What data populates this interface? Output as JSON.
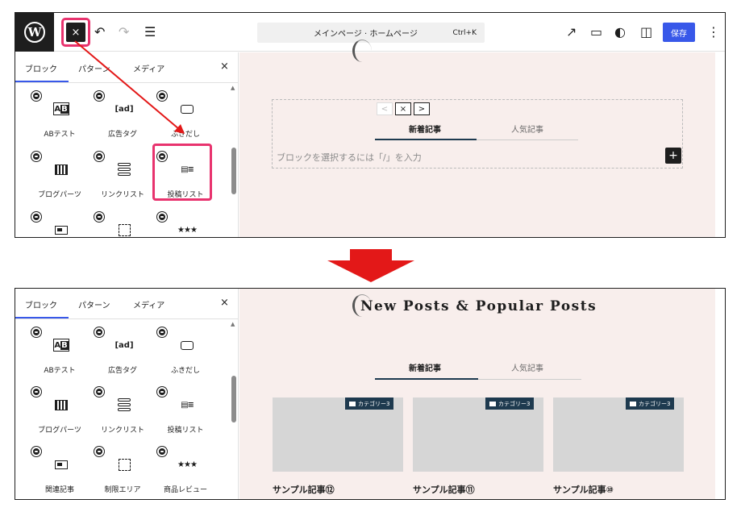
{
  "toolbar": {
    "wp_logo": "W",
    "close_icon": "×",
    "undo_icon": "↶",
    "redo_icon": "↷",
    "outline_icon": "☰",
    "command_text": "メインページ · ホームページ",
    "command_shortcut": "Ctrl+K",
    "view_icon": "↗",
    "device_icon": "▭",
    "style_icon": "◐",
    "settings_icon": "◫",
    "save_label": "保存",
    "more_icon": "⋮"
  },
  "inserter": {
    "tabs": [
      "ブロック",
      "パターン",
      "メディア"
    ],
    "close_icon": "×",
    "scroll_up_icon": "▲",
    "blocks": [
      {
        "label": "ABテスト",
        "icon": "ab-test-icon"
      },
      {
        "label": "広告タグ",
        "icon": "ad-tag-icon",
        "glyph": "[ad]"
      },
      {
        "label": "ふきだし",
        "icon": "speech-bubble-icon"
      },
      {
        "label": "ブログパーツ",
        "icon": "blog-parts-icon"
      },
      {
        "label": "リンクリスト",
        "icon": "link-list-icon"
      },
      {
        "label": "投稿リスト",
        "icon": "post-list-icon",
        "glyph": "▤≡"
      },
      {
        "label": "関連記事",
        "icon": "related-posts-icon"
      },
      {
        "label": "制限エリア",
        "icon": "restricted-area-icon"
      },
      {
        "label": "商品レビュー",
        "icon": "product-review-icon",
        "glyph": "★★★"
      }
    ],
    "ab_glyph": "A",
    "ab_glyph_b": "B"
  },
  "canvas_before": {
    "tool_prev": "<",
    "tool_close": "×",
    "tool_next": ">",
    "tab_new": "新着記事",
    "tab_popular": "人気記事",
    "placeholder": "ブロックを選択するには「/」を入力",
    "plus_icon": "+"
  },
  "canvas_after": {
    "heading": "New Posts & Popular Posts",
    "tab_new": "新着記事",
    "tab_popular": "人気記事",
    "cards": [
      {
        "category": "カテゴリー3",
        "title": "サンプル記事⑫"
      },
      {
        "category": "カテゴリー3",
        "title": "サンプル記事⑪"
      },
      {
        "category": "カテゴリー3",
        "title": "サンプル記事⑩"
      }
    ]
  },
  "colors": {
    "highlight": "#e8336e",
    "arrow": "#e31818",
    "accent": "#3858e9",
    "tab_active": "#1e3a4f",
    "canvas_bg": "#f8eeec"
  }
}
